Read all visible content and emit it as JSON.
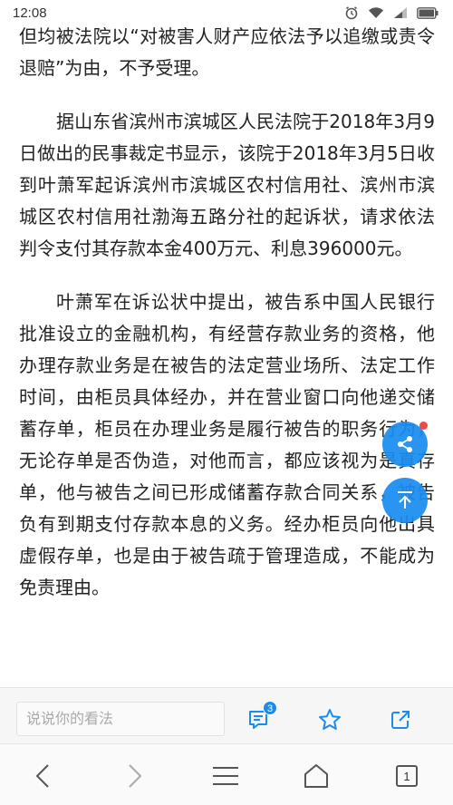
{
  "status_bar": {
    "time": "12:08",
    "icons": [
      "alarm-icon",
      "wifi-icon",
      "signal-icon",
      "battery-icon"
    ]
  },
  "article": {
    "paragraphs": [
      "但均被法院以“对被害人财产应依法予以追缴或责令退赔”为由，不予受理。",
      "据山东省滨州市滨城区人民法院于2018年3月9日做出的民事裁定书显示，该院于2018年3月5日收到叶萧军起诉滨州市滨城区农村信用社、滨州市滨城区农村信用社渤海五路分社的起诉状，请求依法判令支付其存款本金400万元、利息396000元。",
      "叶萧军在诉讼状中提出，被告系中国人民银行批准设立的金融机构，有经营存款业务的资格，他办理存款业务是在被告的法定营业场所、法定工作时间，由柜员具体经办，并在营业窗口向他递交储蓄存单，柜员在办理业务是履行被告的职务行为，无论存单是否伪造，对他而言，都应该视为是真存单，他与被告之间已形成储蓄存款合同关系，被告负有到期支付存款本息的义务。经办柜员向他出具虚假存单，也是由于被告疏于管理造成，不能成为免责理由。"
    ]
  },
  "comment_bar": {
    "placeholder": "说说你的看法",
    "comment_count": "3"
  },
  "nav_bar": {
    "tab_count": "1"
  },
  "colors": {
    "accent": "#1a8cf0",
    "notification_dot": "#f23b3b"
  }
}
